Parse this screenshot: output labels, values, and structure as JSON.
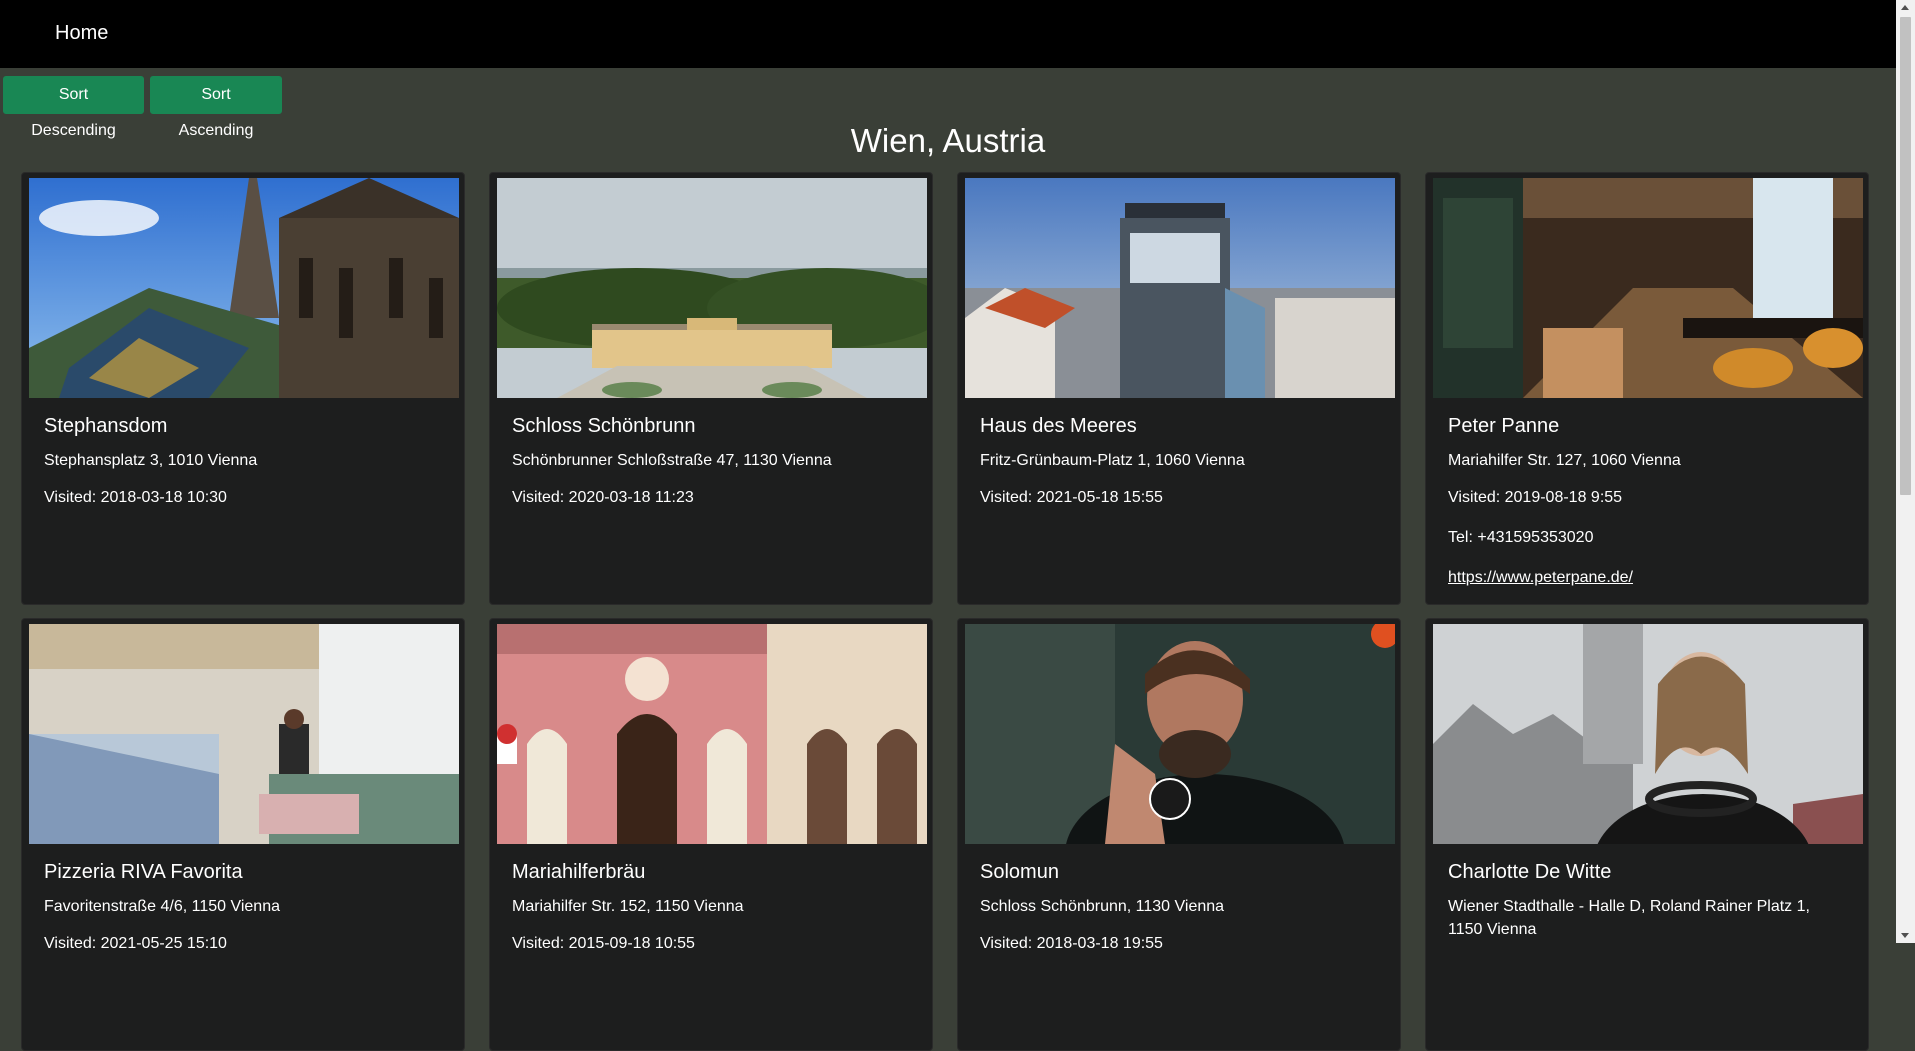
{
  "nav": {
    "home_label": "Home"
  },
  "toolbar": {
    "sort_desc_label": "Sort Descending",
    "sort_asc_label": "Sort Ascending"
  },
  "colors": {
    "page_bg": "#3a3f37",
    "navbar_bg": "#000000",
    "button_bg": "#198754",
    "card_bg": "#1d1e1e"
  },
  "page": {
    "title": "Wien, Austria"
  },
  "cards": [
    {
      "title": "Stephansdom",
      "address": "Stephansplatz 3, 1010 Vienna",
      "visited": "Visited: 2018-03-18 10:30",
      "image": "cathedral-photo"
    },
    {
      "title": "Schloss Schönbrunn",
      "address": "Schönbrunner Schloßstraße 47, 1130 Vienna",
      "visited": "Visited: 2020-03-18 11:23",
      "image": "palace-aerial-photo"
    },
    {
      "title": "Haus des Meeres",
      "address": "Fritz-Grünbaum-Platz 1, 1060 Vienna",
      "visited": "Visited: 2021-05-18 15:55",
      "image": "tower-building-photo"
    },
    {
      "title": "Peter Panne",
      "address": "Mariahilfer Str. 127, 1060 Vienna",
      "visited": "Visited: 2019-08-18 9:55",
      "tel": "Tel: +431595353020",
      "link": "https://www.peterpane.de/",
      "image": "restaurant-interior-photo"
    },
    {
      "title": "Pizzeria RIVA Favorita",
      "address": "Favoritenstraße 4/6, 1150 Vienna",
      "visited": "Visited: 2021-05-25 15:10",
      "image": "pizzeria-interior-photo"
    },
    {
      "title": "Mariahilferbräu",
      "address": "Mariahilfer Str. 152, 1150 Vienna",
      "visited": "Visited: 2015-09-18 10:55",
      "image": "pink-facade-photo"
    },
    {
      "title": "Solomun",
      "address": "Schloss Schönbrunn, 1130 Vienna",
      "visited": "Visited: 2018-03-18 19:55",
      "image": "dj-portrait-photo"
    },
    {
      "title": "Charlotte De Witte",
      "address": "Wiener Stadthalle - Halle D, Roland Rainer Platz 1, 1150 Vienna",
      "visited": "",
      "image": "dj-portrait-photo-2"
    }
  ]
}
